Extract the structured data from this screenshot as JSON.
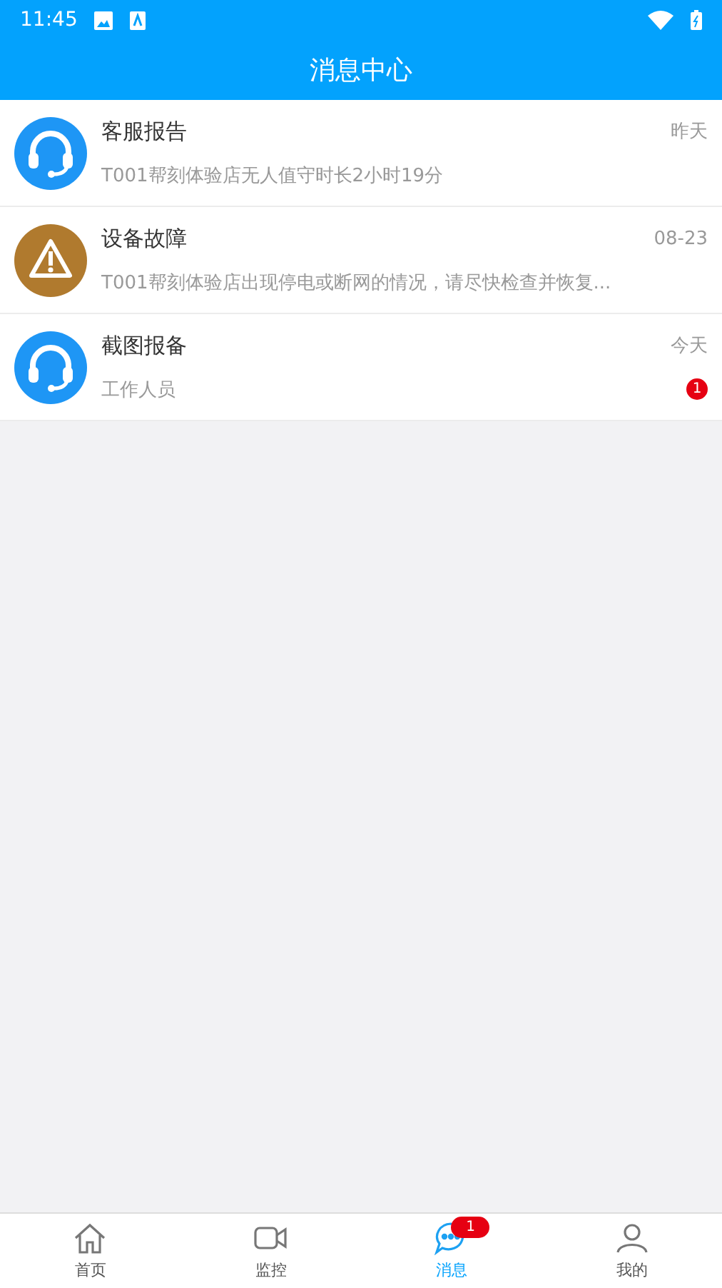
{
  "status_bar": {
    "time": "11:45"
  },
  "header": {
    "title": "消息中心"
  },
  "messages": [
    {
      "kind": "service",
      "title": "客服报告",
      "time": "昨天",
      "preview": "T001帮刻体验店无人值守时长2小时19分"
    },
    {
      "kind": "warning",
      "title": "设备故障",
      "time": "08-23",
      "preview": "T001帮刻体验店出现停电或断网的情况，请尽快检查并恢复..."
    },
    {
      "kind": "service",
      "title": "截图报备",
      "time": "今天",
      "preview": "工作人员",
      "badge": "1"
    }
  ],
  "tab_bar": [
    {
      "kind": "home",
      "label": "首页",
      "selected": false
    },
    {
      "kind": "video",
      "label": "监控",
      "selected": false
    },
    {
      "kind": "chat",
      "label": "消息",
      "selected": true,
      "badge": "1"
    },
    {
      "kind": "user",
      "label": "我的",
      "selected": false
    }
  ]
}
